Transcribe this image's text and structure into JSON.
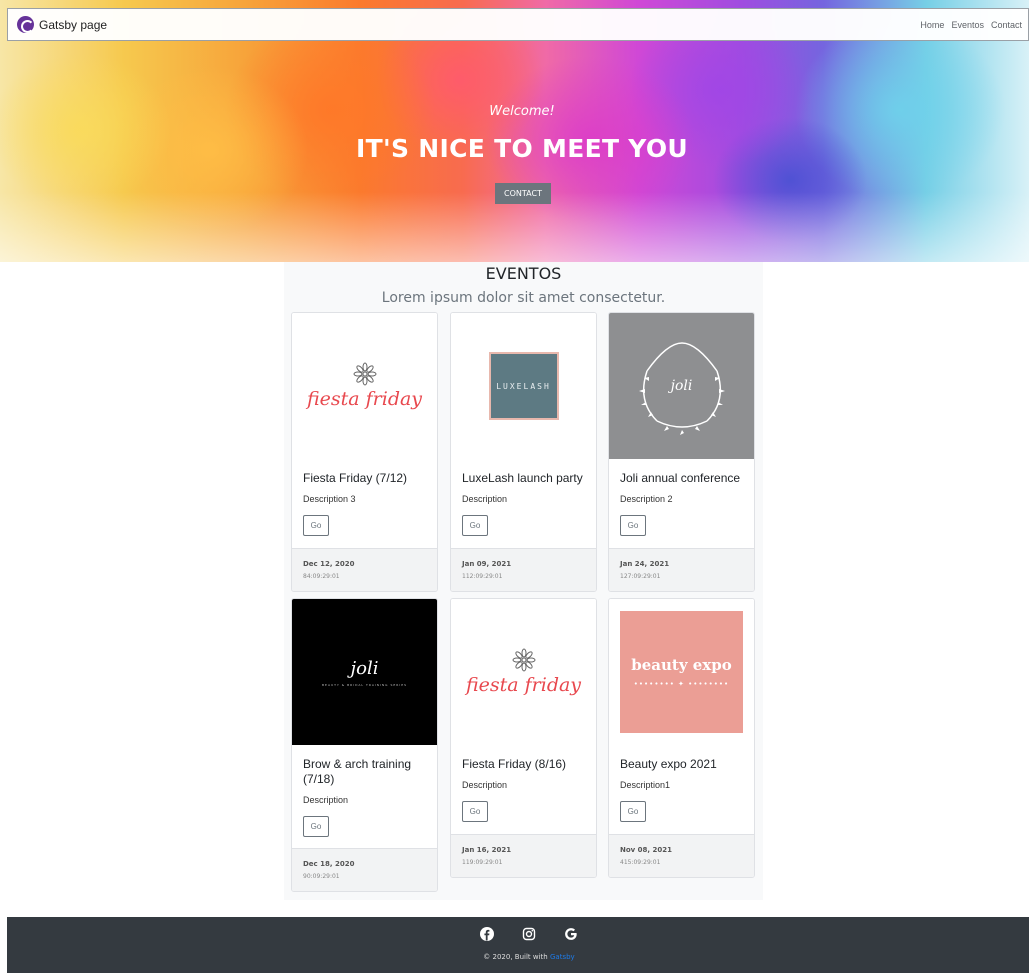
{
  "navbar": {
    "brand": "Gatsby page",
    "links": [
      "Home",
      "Eventos",
      "Contact"
    ]
  },
  "hero": {
    "welcome": "Welcome!",
    "title": "IT'S NICE TO MEET YOU",
    "button": "CONTACT"
  },
  "events": {
    "title": "EVENTOS",
    "subtitle": "Lorem ipsum dolor sit amet consectetur.",
    "cards": [
      {
        "image_text": "fiesta friday",
        "title": "Fiesta Friday (7/12)",
        "description": "Description 3",
        "button": "Go",
        "date": "Dec 12, 2020",
        "countdown": "84:09:29:01"
      },
      {
        "image_text": "LUXELASH",
        "title": "LuxeLash launch party",
        "description": "Description",
        "button": "Go",
        "date": "Jan 09, 2021",
        "countdown": "112:09:29:01"
      },
      {
        "image_text": "joli",
        "title": "Joli annual conference",
        "description": "Description 2",
        "button": "Go",
        "date": "Jan 24, 2021",
        "countdown": "127:09:29:01"
      },
      {
        "image_text": "joli",
        "image_subtext": "BEAUTY & BRIDAL TRAINING SERIES",
        "title": "Brow & arch training (7/18)",
        "description": "Description",
        "button": "Go",
        "date": "Dec 18, 2020",
        "countdown": "90:09:29:01"
      },
      {
        "image_text": "fiesta friday",
        "title": "Fiesta Friday (8/16)",
        "description": "Description",
        "button": "Go",
        "date": "Jan 16, 2021",
        "countdown": "119:09:29:01"
      },
      {
        "image_text": "beauty expo",
        "title": "Beauty expo 2021",
        "description": "Description1",
        "button": "Go",
        "date": "Nov 08, 2021",
        "countdown": "415:09:29:01"
      }
    ]
  },
  "footer": {
    "icons": [
      "facebook-icon",
      "instagram-icon",
      "google-icon"
    ],
    "copyright_prefix": "© 2020, Built with",
    "copyright_link": "Gatsby"
  },
  "colors": {
    "footer_bg": "#343a40",
    "accent_link": "#1e7ae6",
    "button_gray": "#6c757d",
    "brand_purple": "#663399"
  }
}
